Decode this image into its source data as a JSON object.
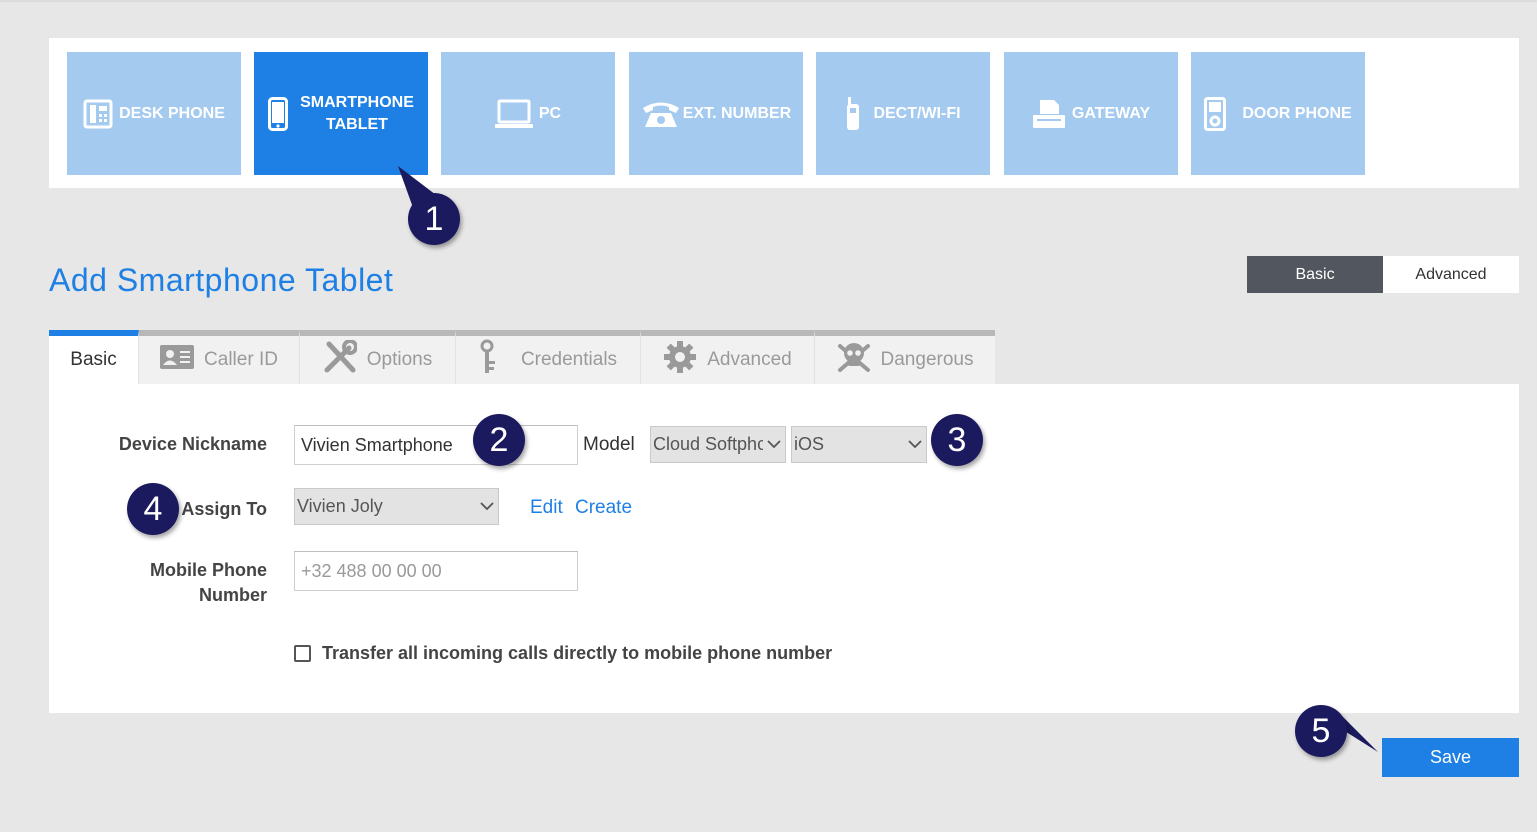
{
  "device_types": [
    {
      "label": "DESK PHONE",
      "icon": "desk-phone-icon",
      "active": false
    },
    {
      "label": "SMARTPHONE\nTABLET",
      "line1": "SMARTPHONE",
      "line2": "TABLET",
      "icon": "smartphone-icon",
      "active": true
    },
    {
      "label": "PC",
      "icon": "pc-icon",
      "active": false
    },
    {
      "label": "EXT. NUMBER",
      "icon": "telephone-icon",
      "active": false
    },
    {
      "label": "DECT/WI-FI",
      "icon": "dect-phone-icon",
      "active": false
    },
    {
      "label": "GATEWAY",
      "icon": "gateway-icon",
      "active": false
    },
    {
      "label": "DOOR PHONE",
      "icon": "door-phone-icon",
      "active": false
    }
  ],
  "page_title": "Add Smartphone Tablet",
  "mode_toggle": {
    "basic": "Basic",
    "advanced": "Advanced",
    "selected": "Basic"
  },
  "tabs": [
    {
      "label": "Basic",
      "icon": "",
      "active": true
    },
    {
      "label": "Caller ID",
      "icon": "id-card-icon",
      "active": false
    },
    {
      "label": "Options",
      "icon": "tools-icon",
      "active": false
    },
    {
      "label": "Credentials",
      "icon": "key-icon",
      "active": false
    },
    {
      "label": "Advanced",
      "icon": "gear-icon",
      "active": false
    },
    {
      "label": "Dangerous",
      "icon": "skull-icon",
      "active": false
    }
  ],
  "form": {
    "device_nickname_label": "Device Nickname",
    "device_nickname_value": "Vivien Smartphone",
    "model_label": "Model",
    "model_value": "Cloud Softphc",
    "os_value": "iOS",
    "assign_to_label": "Assign To",
    "assign_to_value": "Vivien Joly",
    "edit_link": "Edit",
    "create_link": "Create",
    "mobile_label_line1": "Mobile Phone",
    "mobile_label_line2": "Number",
    "mobile_placeholder": "+32 488 00 00 00",
    "transfer_label": "Transfer all incoming calls directly to mobile phone number",
    "transfer_checked": false
  },
  "save_label": "Save",
  "callouts": [
    "1",
    "2",
    "3",
    "4",
    "5"
  ],
  "colors": {
    "accent": "#1e80e4",
    "tile_inactive": "#a5caf0",
    "callout": "#1c1a5e",
    "toggle_on": "#52565f"
  }
}
